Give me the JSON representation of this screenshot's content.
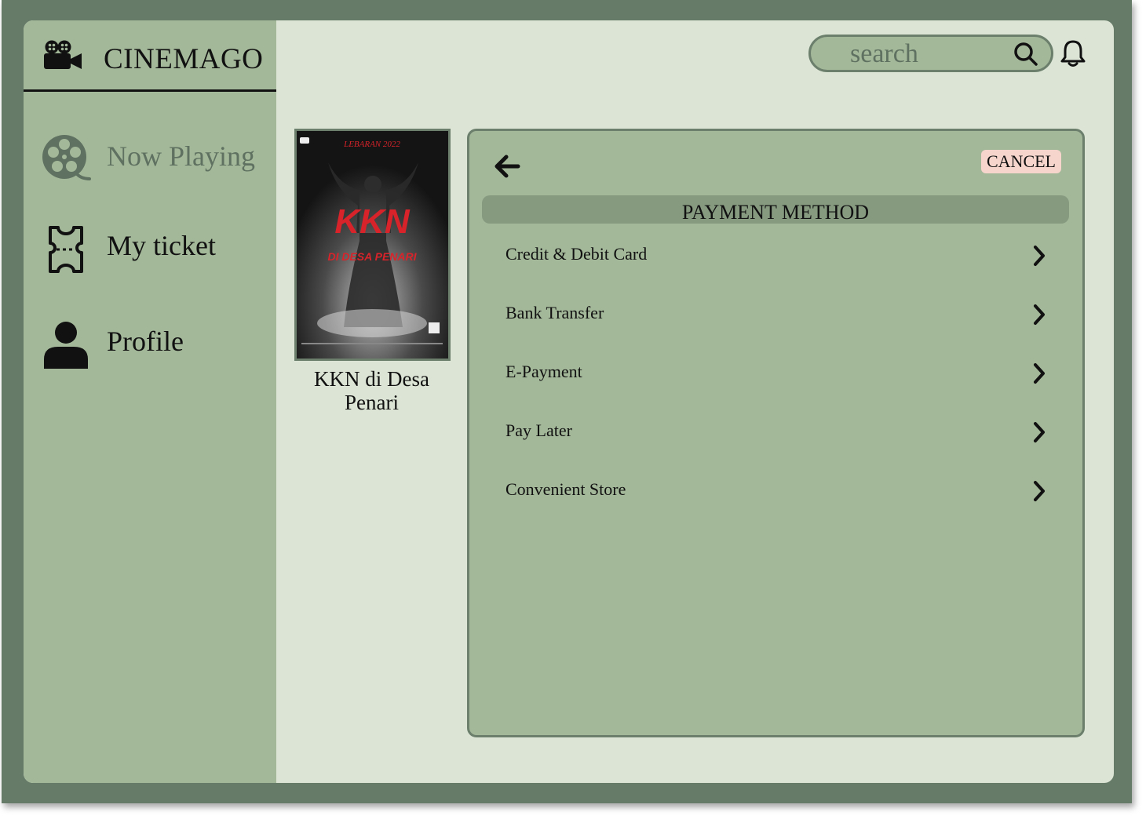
{
  "app": {
    "name": "CINEMAGO"
  },
  "sidebar": {
    "items": [
      {
        "label": "Now Playing",
        "icon": "film-reel-icon",
        "active": true
      },
      {
        "label": "My ticket",
        "icon": "ticket-icon",
        "active": false
      },
      {
        "label": "Profile",
        "icon": "user-icon",
        "active": false
      }
    ]
  },
  "search": {
    "placeholder": "search",
    "value": ""
  },
  "movie": {
    "title": "KKN di Desa Penari",
    "poster_text": "KKN",
    "poster_subtitle": "DI DESA PENARI",
    "poster_top": "LEBARAN 2022"
  },
  "payment": {
    "title": "PAYMENT METHOD",
    "cancel_label": "CANCEL",
    "methods": [
      "Credit & Debit Card",
      "Bank Transfer",
      "E-Payment",
      "Pay Later",
      "Convenient Store"
    ]
  },
  "colors": {
    "frame": "#677c68",
    "screen": "#dce5d5",
    "sidebar": "#a3b899",
    "header_bar": "#869a80",
    "cancel": "#f6d5cc",
    "poster_red": "#d8232a"
  }
}
